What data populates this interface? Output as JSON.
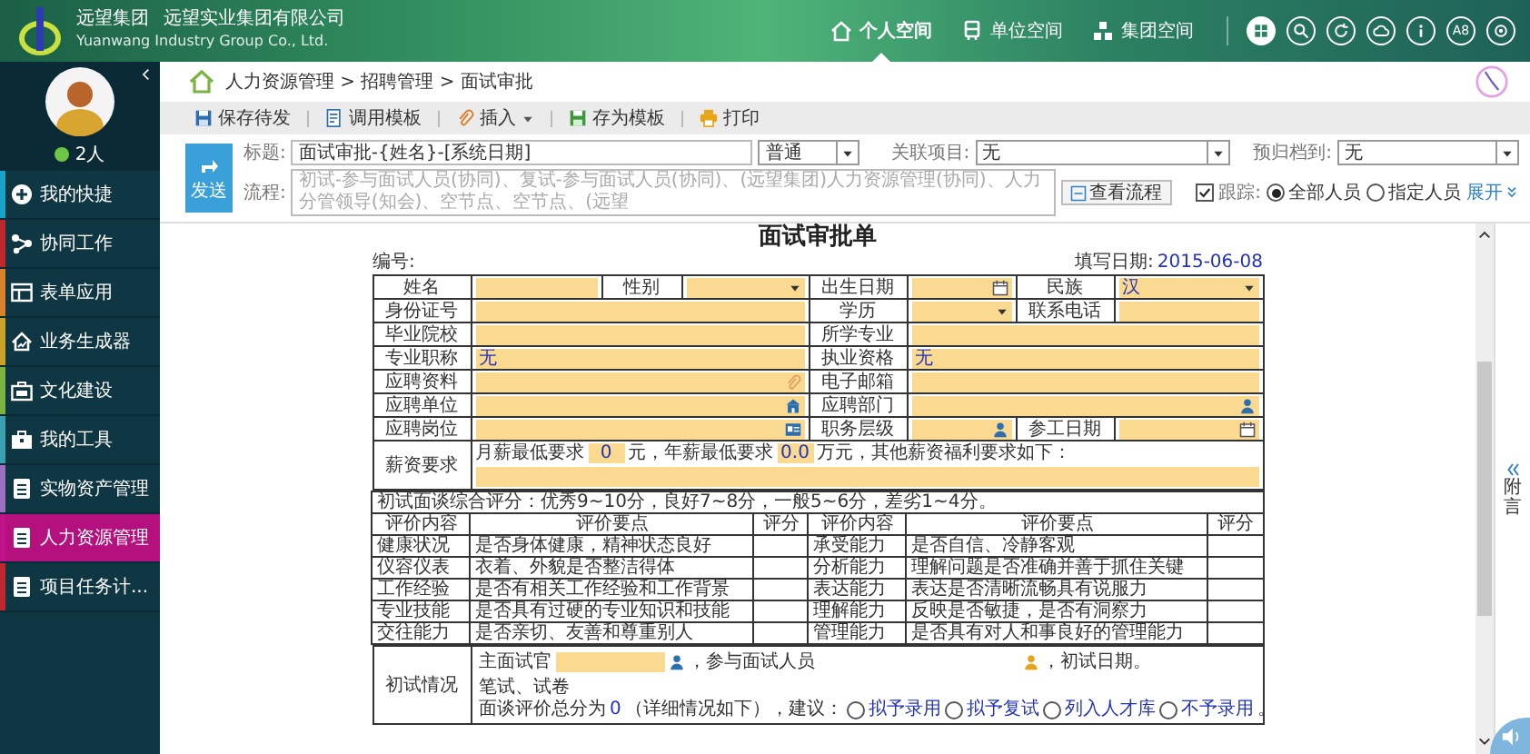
{
  "header": {
    "company_short": "远望集团",
    "company_full": "远望实业集团有限公司",
    "company_en": "Yuanwang Industry Group Co., Ltd.",
    "nav": [
      {
        "label": "个人空间",
        "kind": "home",
        "selected": true
      },
      {
        "label": "单位空间",
        "kind": "bus",
        "selected": false
      },
      {
        "label": "集团空间",
        "kind": "org",
        "selected": false
      }
    ],
    "tools": [
      {
        "kind": "apps",
        "selected": true
      },
      {
        "kind": "search",
        "selected": false
      },
      {
        "kind": "refresh",
        "selected": false
      },
      {
        "kind": "cloud",
        "selected": false
      },
      {
        "kind": "info",
        "selected": false
      },
      {
        "kind": "text",
        "label": "A8",
        "selected": false
      },
      {
        "kind": "settings",
        "selected": false
      }
    ]
  },
  "user": {
    "count": "2人",
    "online": true
  },
  "sidebar": {
    "items": [
      {
        "label": "我的快捷",
        "kind": "plus",
        "color": "#1aa3c8",
        "selected": false
      },
      {
        "label": "协同工作",
        "kind": "share",
        "color": "#c0272d",
        "selected": false
      },
      {
        "label": "表单应用",
        "kind": "table",
        "color": "#d9822b",
        "selected": false
      },
      {
        "label": "业务生成器",
        "kind": "house",
        "color": "#c9a227",
        "selected": false
      },
      {
        "label": "文化建设",
        "kind": "case",
        "color": "#7cb342",
        "selected": false
      },
      {
        "label": "我的工具",
        "kind": "tool",
        "color": "#3aa0b0",
        "selected": false
      },
      {
        "label": "实物资产管理",
        "kind": "doc",
        "color": "#9c6fc1",
        "selected": false
      },
      {
        "label": "人力资源管理",
        "kind": "doc",
        "color": "#c0128a",
        "selected": true
      },
      {
        "label": "项目任务计...",
        "kind": "doc",
        "color": "#c0272d",
        "selected": false
      }
    ]
  },
  "breadcrumb": "人力资源管理 > 招聘管理 > 面试审批",
  "toolbar": [
    {
      "label": "保存待发",
      "kind": "save",
      "dropdown": false
    },
    {
      "label": "调用模板",
      "kind": "template",
      "dropdown": false
    },
    {
      "label": "插入",
      "kind": "attach",
      "dropdown": true
    },
    {
      "label": "存为模板",
      "kind": "saveas",
      "dropdown": false
    },
    {
      "label": "打印",
      "kind": "print",
      "dropdown": false
    }
  ],
  "send": {
    "button": "发送",
    "title_label": "标题:",
    "title_value": "面试审批-{姓名}-[系统日期]",
    "priority": "普通",
    "related_label": "关联项目:",
    "related_value": "无",
    "archive_label": "预归档到:",
    "archive_value": "无",
    "flow_label": "流程:",
    "flow_placeholder": "初试-参与面试人员(协同)、复试-参与面试人员(协同)、(远望集团)人力资源管理(协同)、人力分管领导(知会)、空节点、空节点、(远望",
    "view_flow": "查看流程",
    "track": {
      "label": "跟踪:",
      "checked": true
    },
    "track_options": [
      {
        "label": "全部人员",
        "selected": true
      },
      {
        "label": "指定人员",
        "selected": false
      }
    ],
    "expand": "展开"
  },
  "form": {
    "title": "面试审批单",
    "number_label": "编号:",
    "date_label": "填写日期:",
    "date": "2015-06-08",
    "rows": [
      [
        {
          "kind": "label",
          "text": "姓名"
        },
        {
          "kind": "field"
        },
        {
          "kind": "label",
          "text": "性别"
        },
        {
          "kind": "select"
        },
        {
          "kind": "label",
          "text": "出生日期"
        },
        {
          "kind": "date"
        },
        {
          "kind": "label",
          "text": "民族"
        },
        {
          "kind": "select",
          "value": "汉"
        }
      ],
      [
        {
          "kind": "label",
          "text": "身份证号"
        },
        {
          "kind": "field",
          "colspan": 3
        },
        {
          "kind": "label",
          "text": "学历"
        },
        {
          "kind": "select"
        },
        {
          "kind": "label",
          "text": "联系电话"
        },
        {
          "kind": "field"
        }
      ],
      [
        {
          "kind": "label",
          "text": "毕业院校"
        },
        {
          "kind": "field",
          "colspan": 3
        },
        {
          "kind": "label",
          "text": "所学专业"
        },
        {
          "kind": "field",
          "colspan": 3
        }
      ],
      [
        {
          "kind": "label",
          "text": "专业职称"
        },
        {
          "kind": "field",
          "value": "无",
          "colspan": 3
        },
        {
          "kind": "label",
          "text": "执业资格"
        },
        {
          "kind": "field",
          "value": "无",
          "colspan": 3
        }
      ],
      [
        {
          "kind": "label",
          "text": "应聘资料"
        },
        {
          "kind": "attach_field",
          "colspan": 3
        },
        {
          "kind": "label",
          "text": "电子邮箱"
        },
        {
          "kind": "field",
          "colspan": 3
        }
      ],
      [
        {
          "kind": "label",
          "text": "应聘单位"
        },
        {
          "kind": "org_field",
          "colspan": 3
        },
        {
          "kind": "label",
          "text": "应聘部门"
        },
        {
          "kind": "person_field",
          "colspan": 3
        }
      ],
      [
        {
          "kind": "label",
          "text": "应聘岗位"
        },
        {
          "kind": "post_field",
          "colspan": 3
        },
        {
          "kind": "label",
          "text": "职务层级"
        },
        {
          "kind": "level_field"
        },
        {
          "kind": "label",
          "text": "参工日期"
        },
        {
          "kind": "date"
        }
      ]
    ],
    "salary": {
      "label": "薪资要求",
      "monthly_label": "月薪最低要求",
      "monthly": "0",
      "yearly_label": "元，年薪最低要求",
      "yearly": "0.0",
      "other_label": "万元，其他薪资福利要求如下："
    },
    "score_note": "初试面谈综合评分：优秀9~10分，良好7~8分，一般5~6分，差劣1~4分。",
    "eval_columns": [
      "评价内容",
      "评价要点",
      "评分",
      "评价内容",
      "评价要点",
      "评分"
    ],
    "eval_rows": [
      [
        "健康状况",
        "是否身体健康，精神状态良好",
        "",
        "承受能力",
        "是否自信、冷静客观",
        ""
      ],
      [
        "仪容仪表",
        "衣着、外貌是否整洁得体",
        "",
        "分析能力",
        "理解问题是否准确并善于抓住关键",
        ""
      ],
      [
        "工作经验",
        "是否有相关工作经验和工作背景",
        "",
        "表达能力",
        "表达是否清晰流畅具有说服力",
        ""
      ],
      [
        "专业技能",
        "是否具有过硬的专业知识和技能",
        "",
        "理解能力",
        "反映是否敏捷，是否有洞察力",
        ""
      ],
      [
        "交往能力",
        "是否亲切、友善和尊重别人",
        "",
        "管理能力",
        "是否具有对人和事良好的管理能力",
        ""
      ]
    ],
    "initial": {
      "label": "初试情况",
      "examiner_label": "主面试官",
      "participants_label": "，参与面试人员",
      "date_label": "，初试日期。",
      "written": "笔试、试卷",
      "total_label": "面谈评价总分为",
      "total": "0",
      "detail_label": "（详细情况如下），建议：",
      "decisions": [
        {
          "label": "拟予录用",
          "selected": false
        },
        {
          "label": "拟予复试",
          "selected": false
        },
        {
          "label": "列入人才库",
          "selected": false
        },
        {
          "label": "不予录用",
          "selected": false
        }
      ],
      "end": "。"
    }
  },
  "aside": {
    "label": "附言"
  }
}
